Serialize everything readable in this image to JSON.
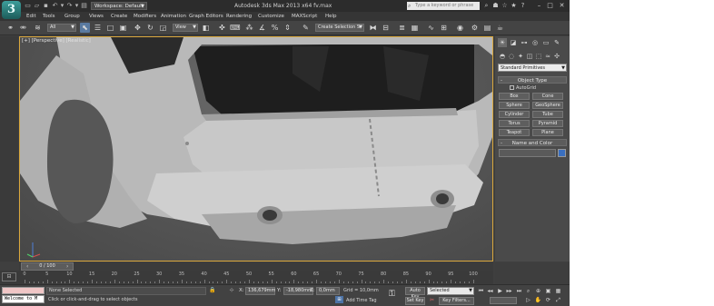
{
  "titlebar": {
    "logo_text": "3",
    "workspace_label": "Workspace: Default",
    "window_title": "Autodesk 3ds Max 2013 x64     fv.max",
    "search_placeholder": "Type a keyword or phrase"
  },
  "menu": {
    "items": [
      "Edit",
      "Tools",
      "Group",
      "Views",
      "Create",
      "Modifiers",
      "Animation",
      "Graph Editors",
      "Rendering",
      "Customize",
      "MAXScript",
      "Help"
    ]
  },
  "toolbar": {
    "filter_dropdown": "All",
    "refcoord_dropdown": "View",
    "selection_set_placeholder": "Create Selection S"
  },
  "viewport": {
    "label": "[+] [Perspective] [Realistic]"
  },
  "command_panel": {
    "primitive_type": "Standard Primitives",
    "object_type_title": "Object Type",
    "autogrid_label": "AutoGrid",
    "object_buttons": [
      "Box",
      "Cone",
      "Sphere",
      "GeoSphere",
      "Cylinder",
      "Tube",
      "Torus",
      "Pyramid",
      "Teapot",
      "Plane"
    ],
    "name_color_title": "Name and Color"
  },
  "timeline": {
    "frame_display": "0 / 100",
    "ticks": [
      "0",
      "5",
      "10",
      "15",
      "20",
      "25",
      "30",
      "35",
      "40",
      "45",
      "50",
      "55",
      "60",
      "65",
      "70",
      "75",
      "80",
      "85",
      "90",
      "95",
      "100"
    ]
  },
  "statusbar": {
    "listener_text": "Welcome to M",
    "selection_status": "None Selected",
    "prompt": "Click or click-and-drag to select objects",
    "x_label": "X:",
    "x_value": "136,679mm",
    "y_label": "Y:",
    "y_value": "-18,980mm",
    "z_label": "Z:",
    "z_value": "0,0mm",
    "grid": "Grid = 10,0mm",
    "add_time_tag": "Add Time Tag",
    "auto_key": "Auto Key",
    "set_key": "Set Key",
    "selected_dropdown": "Selected",
    "key_filters": "Key Filters..."
  },
  "colors": {
    "viewport_border": "#d9a73c",
    "app_background": "#3f3f3f",
    "active_tool": "#5a7aa0"
  }
}
